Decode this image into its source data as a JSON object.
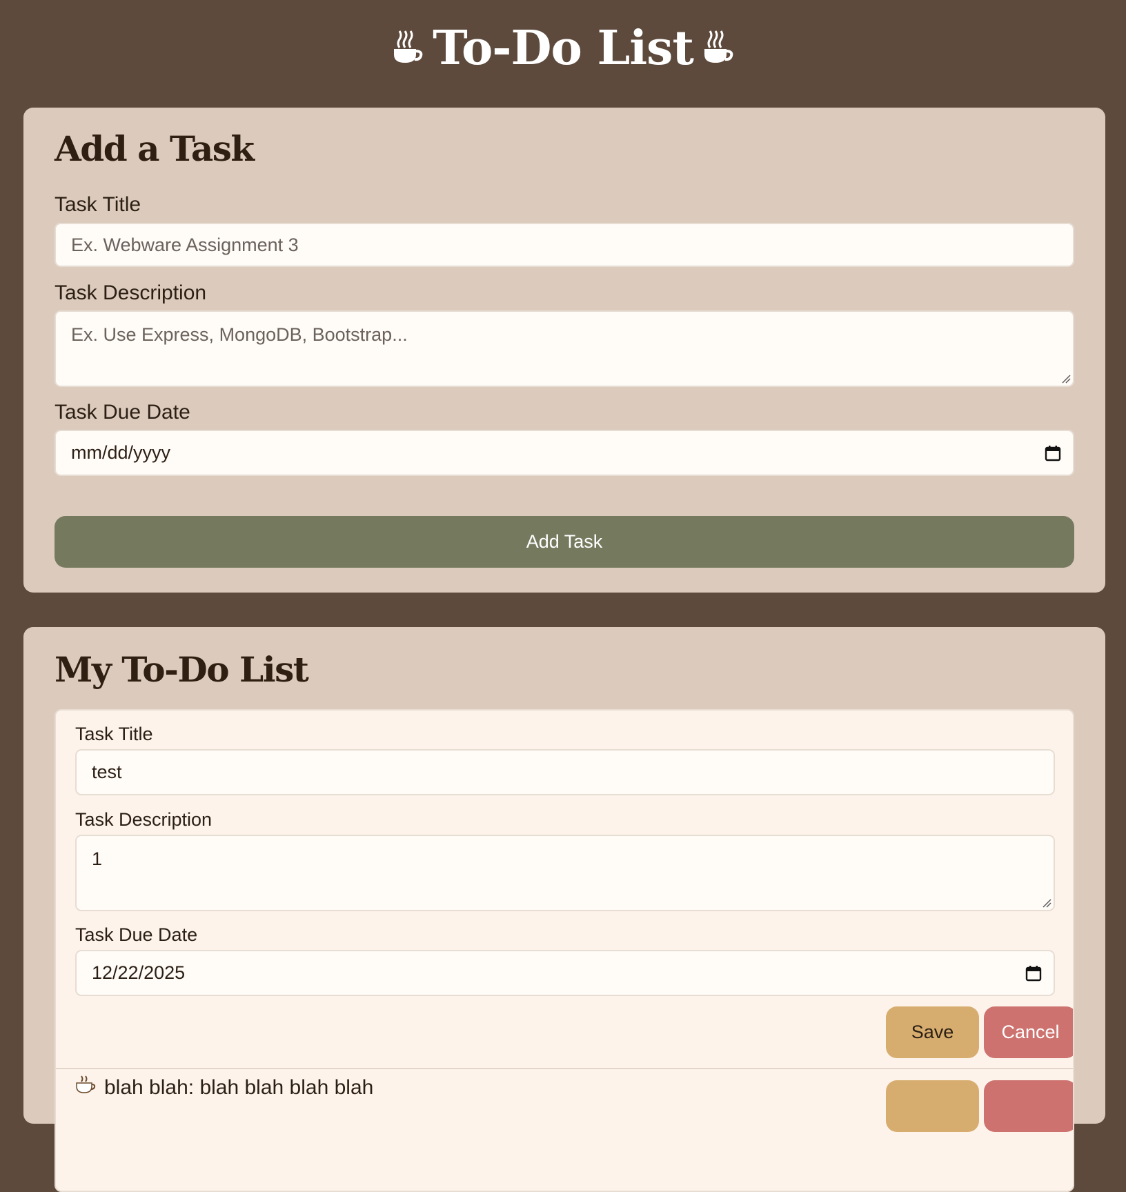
{
  "app": {
    "title": "To-Do List"
  },
  "add_form": {
    "heading": "Add a Task",
    "title_label": "Task Title",
    "title_placeholder": "Ex. Webware Assignment 3",
    "description_label": "Task Description",
    "description_placeholder": "Ex. Use Express, MongoDB, Bootstrap...",
    "due_label": "Task Due Date",
    "due_placeholder": "mm/dd/yyyy",
    "submit_label": "Add Task"
  },
  "list": {
    "heading": "My To-Do List",
    "edit_form": {
      "title_label": "Task Title",
      "title_value": "test",
      "description_label": "Task Description",
      "description_value": "1",
      "due_label": "Task Due Date",
      "due_value": "12/22/2025",
      "save_label": "Save",
      "cancel_label": "Cancel"
    },
    "items": [
      {
        "icon": "coffee-icon",
        "text": "blah blah: blah blah blah blah"
      }
    ]
  },
  "colors": {
    "background": "#5d4a3c",
    "card": "#dccbbd",
    "add_button": "#757a5f",
    "save_button": "#d7ad6f",
    "cancel_button": "#cd726f"
  }
}
